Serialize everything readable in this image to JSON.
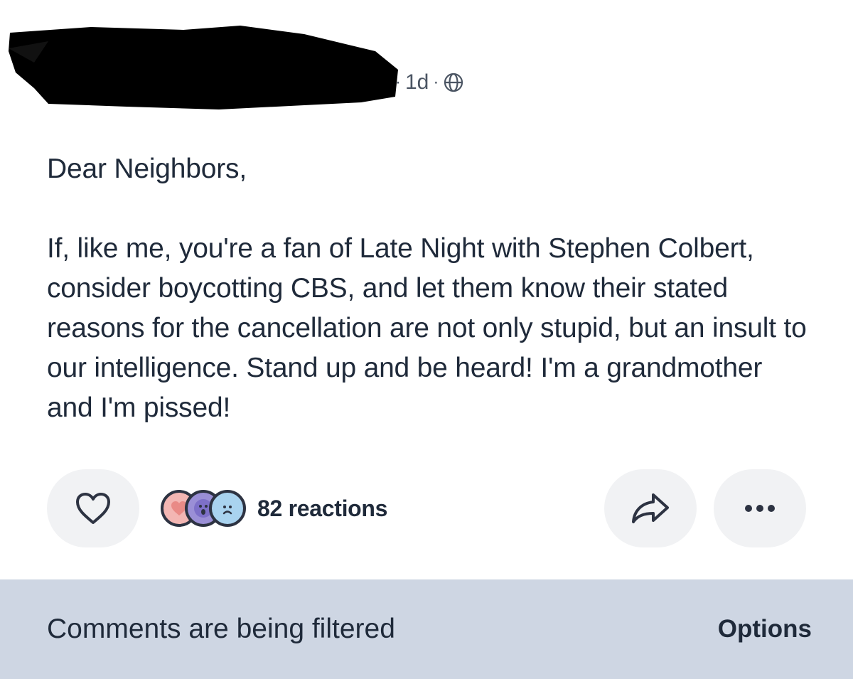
{
  "post": {
    "timestamp": "1d",
    "separator": "·",
    "visibility_icon": "globe-icon",
    "greeting": "Dear Neighbors,",
    "body": "If, like me, you're a fan of Late Night with Stephen Colbert, consider boycotting CBS, and let them know their stated reasons for the cancellation are not only stupid, but an insult to our intelligence. Stand up and be heard! I'm a grandmother and I'm pissed!"
  },
  "actions": {
    "like_icon": "heart-icon",
    "reaction_icons": [
      "heart-reaction-icon",
      "surprised-reaction-icon",
      "sad-reaction-icon"
    ],
    "reactions_label": "82 reactions",
    "share_icon": "share-arrow-icon",
    "more_icon": "more-dots-icon"
  },
  "footer": {
    "message": "Comments are being filtered",
    "options_label": "Options"
  },
  "colors": {
    "footer_bg": "#ced6e3",
    "button_bg": "#f1f2f4",
    "text": "#1f2a3a"
  }
}
